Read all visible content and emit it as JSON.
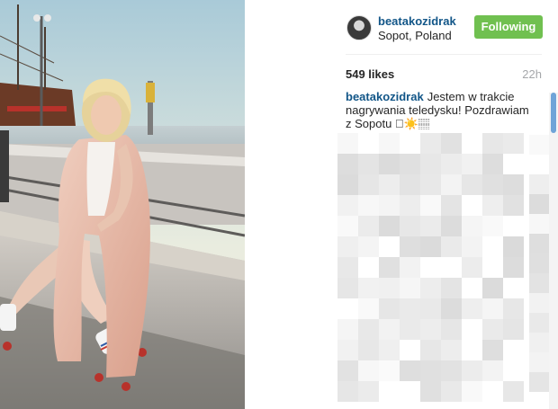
{
  "post": {
    "username": "beatakozidrak",
    "location": "Sopot, Poland",
    "follow_label": "Following",
    "likes": "549 likes",
    "time": "22h",
    "caption_user": "beatakozidrak",
    "caption_text": "Jestem w trakcie nagrywania teledysku! Pozdrawiam z Sopotu 🏽☀️🏽"
  },
  "colors": {
    "username": "#125688",
    "follow_button": "#70c050",
    "scroll_thumb": "#6fa4d8"
  }
}
